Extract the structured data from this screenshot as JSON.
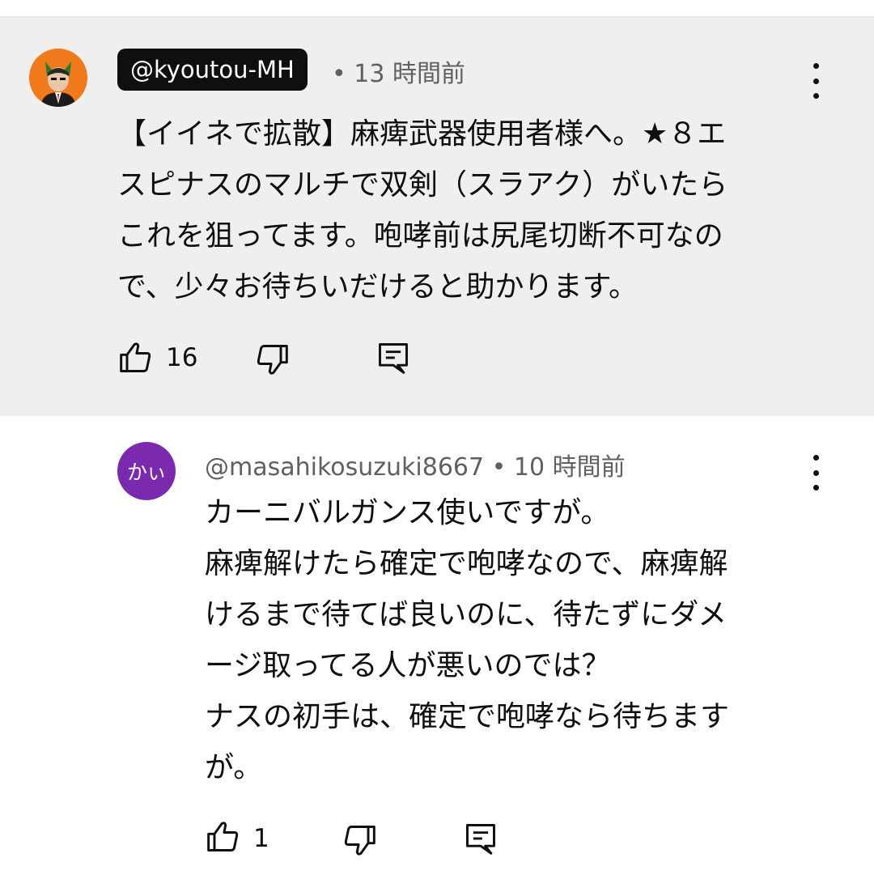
{
  "comments": [
    {
      "author": "@kyoutou-MH",
      "time": "• 13 時間前",
      "text_lines": [
        "【イイネで拡散】麻痺武器使用者様へ。★８エ",
        "スピナスのマルチで双剣（スラアク）がいたら",
        "これを狙ってます。咆哮前は尻尾切断不可なの",
        "で、少々お待ちいだけると助かります。"
      ],
      "likes": "16",
      "avatar_icon": "profile-avatar-icon",
      "avatar_color": "#f07a1c"
    },
    {
      "author": "@masahikosuzuki8667",
      "time": "• 10 時間前",
      "avatar_text": "かぃ",
      "avatar_color": "#7b2ab0",
      "text_lines": [
        "カーニバルガンス使いですが。",
        "麻痺解けたら確定で咆哮なので、麻痺解",
        "けるまで待てば良いのに、待たずにダメ",
        "ージ取ってる人が悪いのでは？",
        "ナスの初手は、確定で咆哮なら待ちます",
        "が。"
      ],
      "likes": "1"
    }
  ],
  "icons": {
    "like": "thumbs-up-icon",
    "dislike": "thumbs-down-icon",
    "reply": "reply-icon",
    "menu": "more-vert-icon"
  },
  "colors": {
    "highlight_bg": "#efefef",
    "handle_badge_bg": "#0f0f0f",
    "secondary_text": "#606060"
  }
}
